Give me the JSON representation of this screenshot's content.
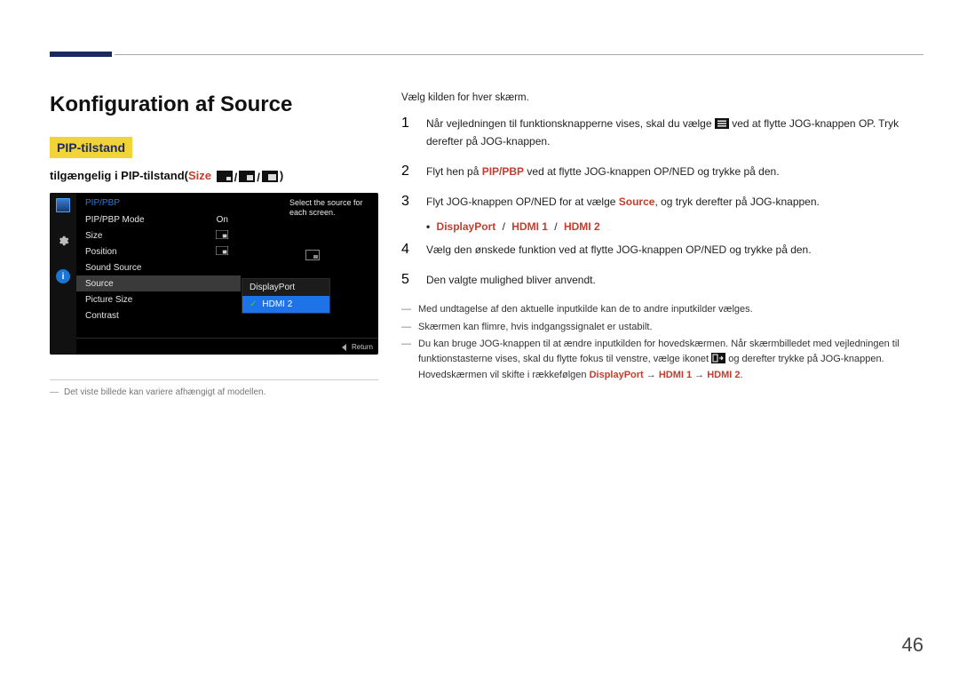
{
  "page_number": "46",
  "title": "Konfiguration af Source",
  "chip": "PIP-tilstand",
  "subline": {
    "prefix": "tilgængelig i PIP-tilstand(",
    "size": "Size",
    "suffix": ")"
  },
  "footnote": {
    "dash": "―",
    "text": "Det viste billede kan variere afhængigt af modellen."
  },
  "osd": {
    "menu_title": "PIP/PBP",
    "items": [
      {
        "label": "PIP/PBP Mode",
        "value": "On"
      },
      {
        "label": "Size",
        "value": "_pip_"
      },
      {
        "label": "Position",
        "value": "_pip_"
      },
      {
        "label": "Sound Source",
        "value": ""
      },
      {
        "label": "Source",
        "value": ""
      },
      {
        "label": "Picture Size",
        "value": ""
      },
      {
        "label": "Contrast",
        "value": ""
      }
    ],
    "submenu": [
      {
        "label": "DisplayPort",
        "hl": false
      },
      {
        "label": "HDMI 2",
        "hl": true
      }
    ],
    "help": "Select the source for each screen.",
    "return": "Return",
    "info_icon": "i"
  },
  "lead": "Vælg kilden for hver skærm.",
  "step1": {
    "a": "Når vejledningen til funktionsknapperne vises, skal du vælge ",
    "b": " ved at flytte JOG-knappen OP. Tryk derefter på JOG-knappen."
  },
  "step2": {
    "a": "Flyt hen på ",
    "k": "PIP/PBP",
    "b": " ved at flytte JOG-knappen OP/NED og trykke på den."
  },
  "step3": {
    "a": "Flyt JOG-knappen OP/NED for at vælge ",
    "k": "Source",
    "b": ", og tryk derefter på JOG-knappen."
  },
  "opts": {
    "dp": "DisplayPort",
    "h1": "HDMI 1",
    "h2": "HDMI 2",
    "sep": "/"
  },
  "step4": "Vælg den ønskede funktion ved at flytte JOG-knappen OP/NED og trykke på den.",
  "step5": "Den valgte mulighed bliver anvendt.",
  "notes": {
    "dash": "―",
    "n1": "Med undtagelse af den aktuelle inputkilde kan de to andre inputkilder vælges.",
    "n2": "Skærmen kan flimre, hvis indgangssignalet er ustabilt.",
    "n3a": "Du kan bruge JOG-knappen til at ændre inputkilden for hovedskærmen. Når skærmbilledet med vejledningen til funktionstasterne vises, skal du flytte fokus til venstre, vælge ikonet ",
    "n3b": " og derefter trykke på JOG-knappen. Hovedskærmen vil skifte i rækkefølgen ",
    "dp": "DisplayPort",
    "h1": "HDMI 1",
    "h2": "HDMI 2",
    "arrow": "→"
  }
}
